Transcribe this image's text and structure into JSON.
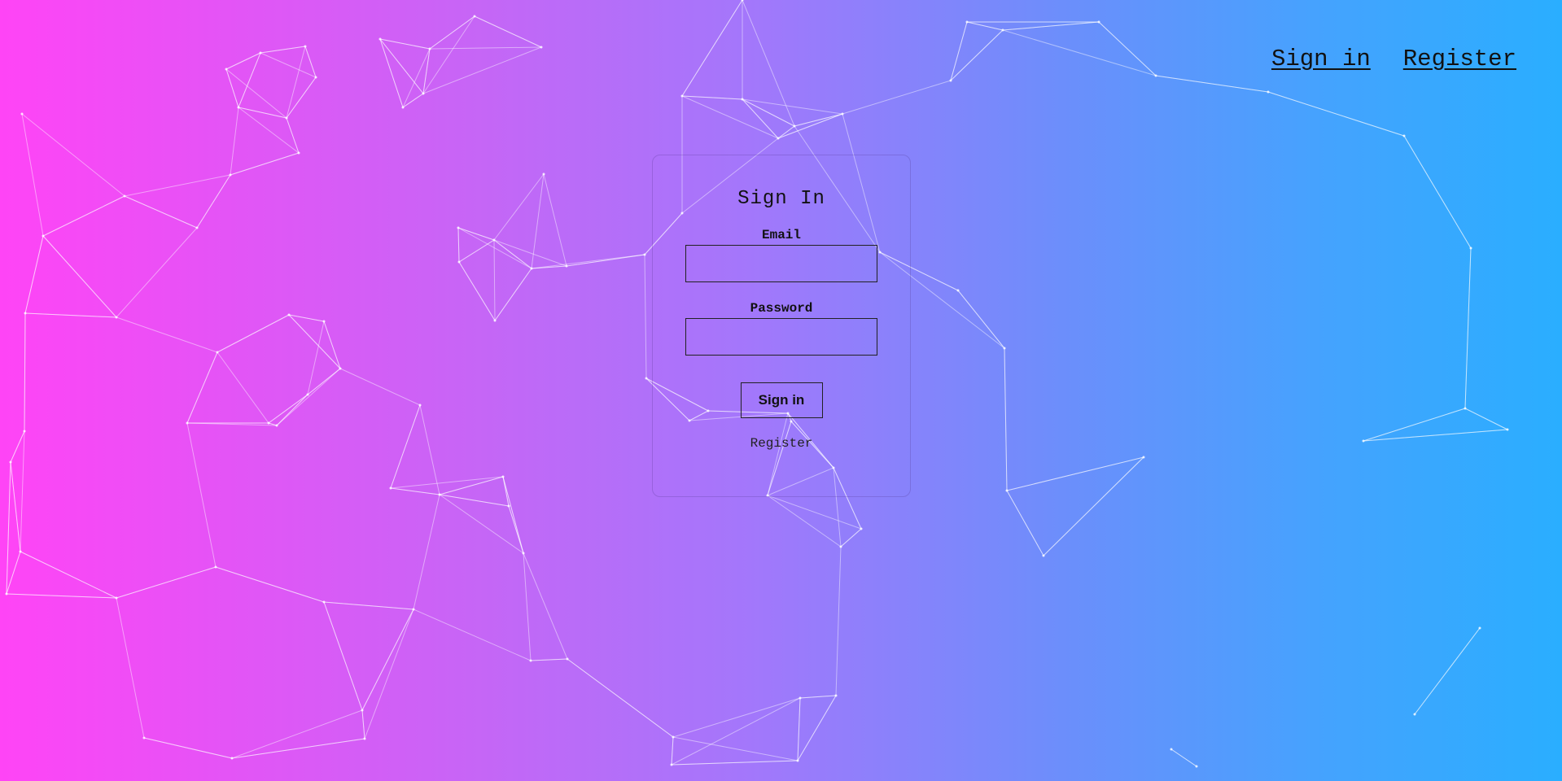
{
  "nav": {
    "signin_label": "Sign in",
    "register_label": "Register"
  },
  "form": {
    "title": "Sign In",
    "email_label": "Email",
    "email_value": "",
    "password_label": "Password",
    "password_value": "",
    "submit_label": "Sign in",
    "register_label": "Register"
  },
  "colors": {
    "gradient_start": "#ff44f6",
    "gradient_end": "#2aaeff"
  }
}
